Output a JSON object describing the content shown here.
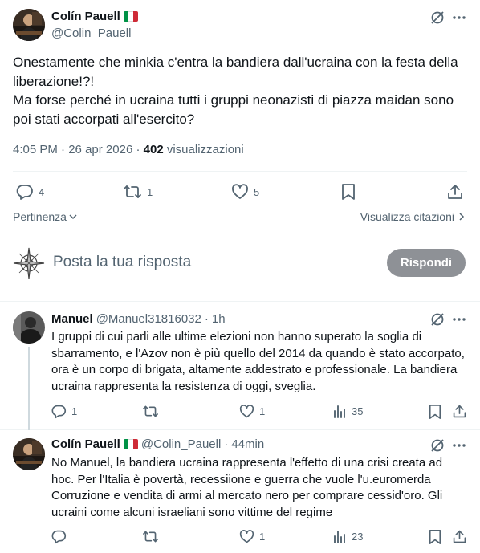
{
  "main_post": {
    "author_name": "Colín Pauell",
    "author_handle": "@Colin_Pauell",
    "text": "Onestamente che minkia c'entra la bandiera dall'ucraina con la festa della liberazione!?!\nMa forse perché in ucraina tutti i gruppi neonazisti di piazza maidan sono poi stati accorpati all'esercito?",
    "time": "4:05 PM",
    "separator": "·",
    "date": "26 apr 2026",
    "views_count": "402",
    "views_label": "visualizzazioni",
    "replies": "4",
    "reposts": "1",
    "likes": "5",
    "relevance_label": "Pertinenza",
    "quotes_label": "Visualizza citazioni"
  },
  "compose": {
    "placeholder": "Posta la tua risposta",
    "reply_button": "Rispondi"
  },
  "replies": [
    {
      "author_name": "Manuel",
      "author_handle": "@Manuel31816032",
      "separator": "·",
      "time": "1h",
      "text": "I gruppi di cui parli alle ultime elezioni non hanno superato la soglia di sbarramento, e l'Azov non è più quello del 2014 da quando è stato accorpato, ora è un corpo di brigata, altamente addestrato e professionale. La bandiera ucraina rappresenta la resistenza di oggi, sveglia.",
      "replies": "1",
      "reposts": "",
      "likes": "1",
      "views": "35"
    },
    {
      "author_name": "Colín Pauell",
      "author_handle": "@Colin_Pauell",
      "separator": "·",
      "time": "44min",
      "text": "No Manuel,  la bandiera ucraina rappresenta l'effetto di una crisi creata ad hoc. Per l'Italia è povertà, recessiione e guerra che vuole l'u.euromerda Corruzione e vendita di armi al mercato nero per comprare cessid'oro. Gli ucraini come alcuni israeliani sono vittime del regime",
      "replies": "",
      "reposts": "",
      "likes": "1",
      "views": "23"
    }
  ],
  "colors": {
    "text": "#0f1419",
    "secondary": "#536471",
    "divider": "#eff3f4",
    "reply_button_bg": "#8e9196",
    "flag": [
      "#009246",
      "#ffffff",
      "#ce2b37"
    ]
  },
  "icons": [
    "grok-icon",
    "more-icon",
    "reply-icon",
    "repost-icon",
    "like-icon",
    "bookmark-icon",
    "share-icon",
    "views-icon",
    "chevron-down-icon",
    "chevron-right-icon",
    "compass-icon",
    "italy-flag-icon"
  ]
}
